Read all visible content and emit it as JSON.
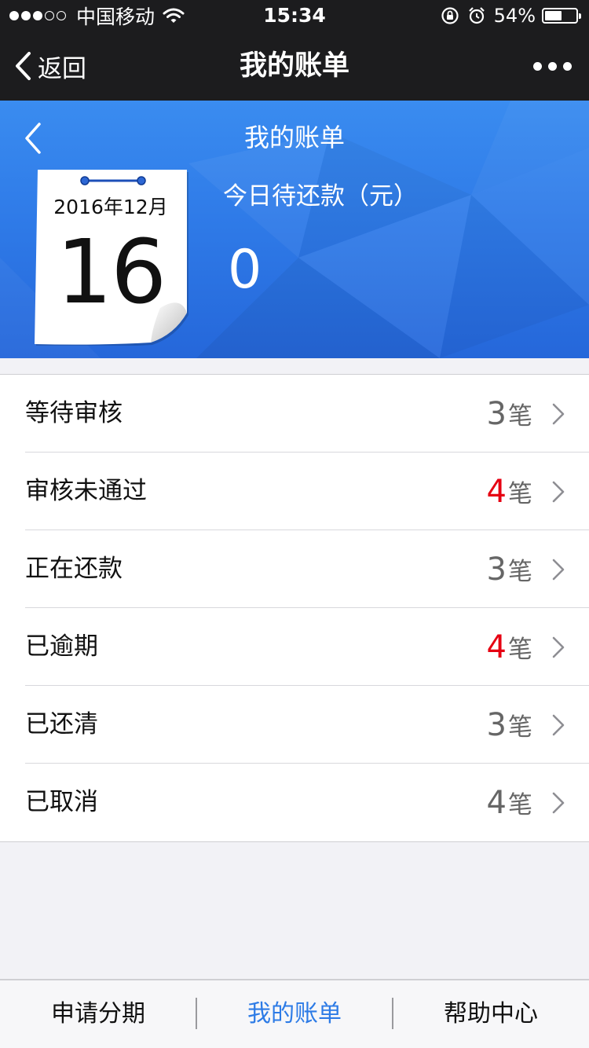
{
  "status_bar": {
    "carrier": "中国移动",
    "time": "15:34",
    "battery_percent_text": "54%",
    "battery_level": 0.54
  },
  "nav": {
    "back_label": "返回",
    "title": "我的账单"
  },
  "header": {
    "title": "我的账单",
    "calendar_date": "2016年12月",
    "calendar_day": "16",
    "due_label": "今日待还款（元）",
    "due_amount": "0"
  },
  "bill_list": [
    {
      "label": "等待审核",
      "count": "3",
      "unit": "笔",
      "highlight": false
    },
    {
      "label": "审核未通过",
      "count": "4",
      "unit": "笔",
      "highlight": true
    },
    {
      "label": "正在还款",
      "count": "3",
      "unit": "笔",
      "highlight": false
    },
    {
      "label": "已逾期",
      "count": "4",
      "unit": "笔",
      "highlight": true
    },
    {
      "label": "已还清",
      "count": "3",
      "unit": "笔",
      "highlight": false
    },
    {
      "label": "已取消",
      "count": "4",
      "unit": "笔",
      "highlight": false
    }
  ],
  "tabs": [
    {
      "label": "申请分期",
      "active": false
    },
    {
      "label": "我的账单",
      "active": true
    },
    {
      "label": "帮助中心",
      "active": false
    }
  ],
  "colors": {
    "accent_blue": "#2d7be6",
    "alert_red": "#e60012",
    "header_blue": "#2f7be8"
  }
}
